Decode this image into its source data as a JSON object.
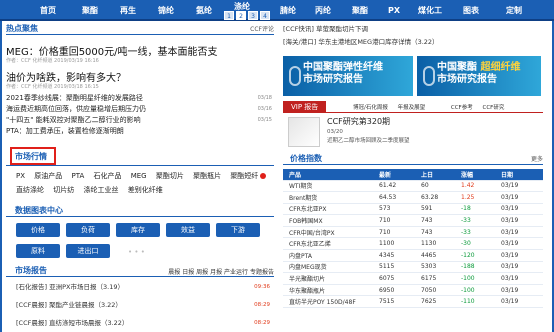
{
  "nav": {
    "items": [
      "首页",
      "聚酯",
      "再生",
      "锦纶",
      "氨纶",
      "涤纶",
      "",
      "",
      "腈纶",
      "丙纶",
      "聚酯",
      "PX",
      "煤化工",
      "图表",
      "定制"
    ],
    "pager": [
      "1",
      "2",
      "3",
      "4"
    ],
    "pager_active": 1
  },
  "hot": {
    "title": "热点聚焦",
    "more": "CCF评论",
    "headline1": "MEG：价格重回5000元/吨一线，基本面能否支",
    "headline1_sub": "作者：CCF 化纤频道   2019/03/19 16:16",
    "headline2": "油价为啥跌，影响有多大？",
    "headline2_sub": "作者：CCF 化纤频道   2019/03/18 16:15",
    "news": [
      {
        "text": "2021春季纱线展：聚酯明星纤维的发展路径",
        "date": "03/18"
      },
      {
        "text": "海运费近期高位回落，供应量稳增后期压力仍",
        "date": "03/16"
      },
      {
        "text": "\"十四五\" 能耗双控对聚酯乙二醇行业的影响",
        "date": "03/15"
      },
      {
        "text": "PTA：加工费承压，装置检修逐渐明朗",
        "date": ""
      }
    ]
  },
  "market": {
    "title": "市场行情",
    "tabs_row1": [
      "PX",
      "原油产品",
      "PTA",
      "石化产品",
      "MEG",
      "聚酯切片",
      "聚酯瓶片",
      "聚酯短纤"
    ],
    "tabs_row2": [
      "直纺涤纶",
      "切片纺",
      "涤纶工业丝",
      "差别化纤维"
    ]
  },
  "data_center": {
    "title": "数据图表中心",
    "row1": [
      "价格",
      "负荷",
      "库存",
      "效益",
      "下游"
    ],
    "row2": [
      "原料",
      "进出口"
    ]
  },
  "reports": {
    "title": "市场报告",
    "filters": [
      "晨报",
      "日报",
      "周报",
      "月报",
      "产业运行",
      "专题报告"
    ],
    "items": [
      {
        "text": "[石化报告] 亚洲PX市场日报（3.19）",
        "date": "09:36"
      },
      {
        "text": "[CCF晨报] 聚酯产业链晨报（3.22）",
        "date": "08:29"
      },
      {
        "text": "[CCF晨报] 直纺涤短市场晨报（3.22）",
        "date": "08:29"
      }
    ]
  },
  "right": {
    "top_news": [
      "[CCF快讯] 草萤聚酯切片下调",
      "[海关/港口] 华东主港地区MEG港口库存详情（3.22）"
    ],
    "banner1": {
      "line1": "中国聚酯弹性纤维",
      "line2": "市场研究报告"
    },
    "banner2": {
      "line1": "中国聚酯",
      "line2": "超细纤维",
      "line3": "市场研究报告"
    },
    "vip": {
      "label": "VIP 报告",
      "links": [
        "博冠/石化周报",
        "年报及展望",
        "CCF参考",
        "CCF研究"
      ]
    },
    "vip_item": {
      "title": "CCF研究第320期",
      "date": "03/20",
      "desc": "近期乙二醇市场回顾及二季度展望"
    },
    "price_title": "价格指数",
    "price_more": "更多",
    "table_head": [
      "产品",
      "最新",
      "上日",
      "涨幅",
      "日期"
    ],
    "table_rows": [
      {
        "name": "WTI期货",
        "now": "61.42",
        "prev": "60",
        "chg": "1.42",
        "date": "03/19",
        "up": true
      },
      {
        "name": "Brent期货",
        "now": "64.53",
        "prev": "63.28",
        "chg": "1.25",
        "date": "03/19",
        "up": true
      },
      {
        "name": "CFR东北亚PX",
        "now": "573",
        "prev": "591",
        "chg": "-18",
        "date": "03/19",
        "up": false
      },
      {
        "name": "FOB韩国MX",
        "now": "710",
        "prev": "743",
        "chg": "-33",
        "date": "03/19",
        "up": false
      },
      {
        "name": "CFR中国/台湾PX",
        "now": "710",
        "prev": "743",
        "chg": "-33",
        "date": "03/19",
        "up": false
      },
      {
        "name": "CFR东北亚乙烯",
        "now": "1100",
        "prev": "1130",
        "chg": "-30",
        "date": "03/19",
        "up": false
      },
      {
        "name": "内盘PTA",
        "now": "4345",
        "prev": "4465",
        "chg": "-120",
        "date": "03/19",
        "up": false
      },
      {
        "name": "内盘MEG现货",
        "now": "5115",
        "prev": "5303",
        "chg": "-188",
        "date": "03/19",
        "up": false
      },
      {
        "name": "半光聚酯切片",
        "now": "6075",
        "prev": "6175",
        "chg": "-100",
        "date": "03/19",
        "up": false
      },
      {
        "name": "华东聚酯瓶片",
        "now": "6950",
        "prev": "7050",
        "chg": "-100",
        "date": "03/19",
        "up": false
      },
      {
        "name": "直纺半光POY 150D/48F",
        "now": "7515",
        "prev": "7625",
        "chg": "-110",
        "date": "03/19",
        "up": false
      }
    ]
  },
  "colors": {
    "brand": "#1b5fb4",
    "up": "#e03a1a",
    "down": "#0a9a3a",
    "vip": "#c0211f"
  }
}
